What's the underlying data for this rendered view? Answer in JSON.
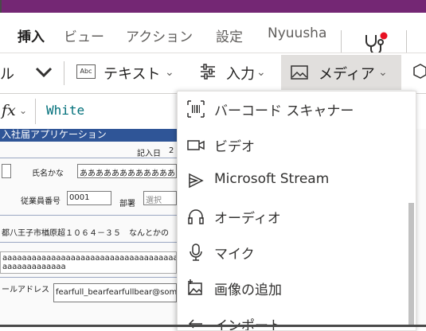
{
  "tabs": [
    {
      "label": "挿入",
      "active": true
    },
    {
      "label": "ビュー"
    },
    {
      "label": "アクション"
    },
    {
      "label": "設定"
    },
    {
      "label": "Nyuusha"
    }
  ],
  "toolbar": {
    "left_partial": "ル",
    "text_label": "テキスト",
    "text_icon_abbr": "Abc",
    "input_label": "入力",
    "media_label": "メディア"
  },
  "formula": {
    "fx": "fx",
    "value": "White"
  },
  "form": {
    "header": "入社届アプリケーション",
    "date_label": "記入日",
    "date_value": "2",
    "kana_label": "氏名かな",
    "kana_value": "ああああああああああああ",
    "emp_label": "従業員番号",
    "emp_value": "0001",
    "dept_label": "部署",
    "dept_placeholder": "選択",
    "address": "都八王子市楢原超１０６４－３５　なんとかの",
    "free_text_1": "aaaaaaaaaaaaaaaaaaaaaaaaaaaaaaaaaaaaaaaaaa",
    "free_text_2": "aaaaaaaaaaaaa",
    "email_label": "ールアドレス",
    "email_value": "fearfull_bearfearfullbear@som"
  },
  "media_menu": {
    "items": [
      {
        "label": "バーコード スキャナー",
        "icon": "barcode-icon"
      },
      {
        "label": "ビデオ",
        "icon": "video-icon"
      },
      {
        "label": "Microsoft Stream",
        "icon": "stream-icon"
      },
      {
        "label": "オーディオ",
        "icon": "headphones-icon"
      },
      {
        "label": "マイク",
        "icon": "microphone-icon"
      },
      {
        "label": "画像の追加",
        "icon": "add-image-icon"
      },
      {
        "label": "インポート",
        "icon": "import-icon"
      }
    ]
  },
  "colors": {
    "brand": "#742774",
    "form_header": "#2f5597",
    "formula_text": "#006f7a",
    "notification_dot": "#e81123"
  }
}
